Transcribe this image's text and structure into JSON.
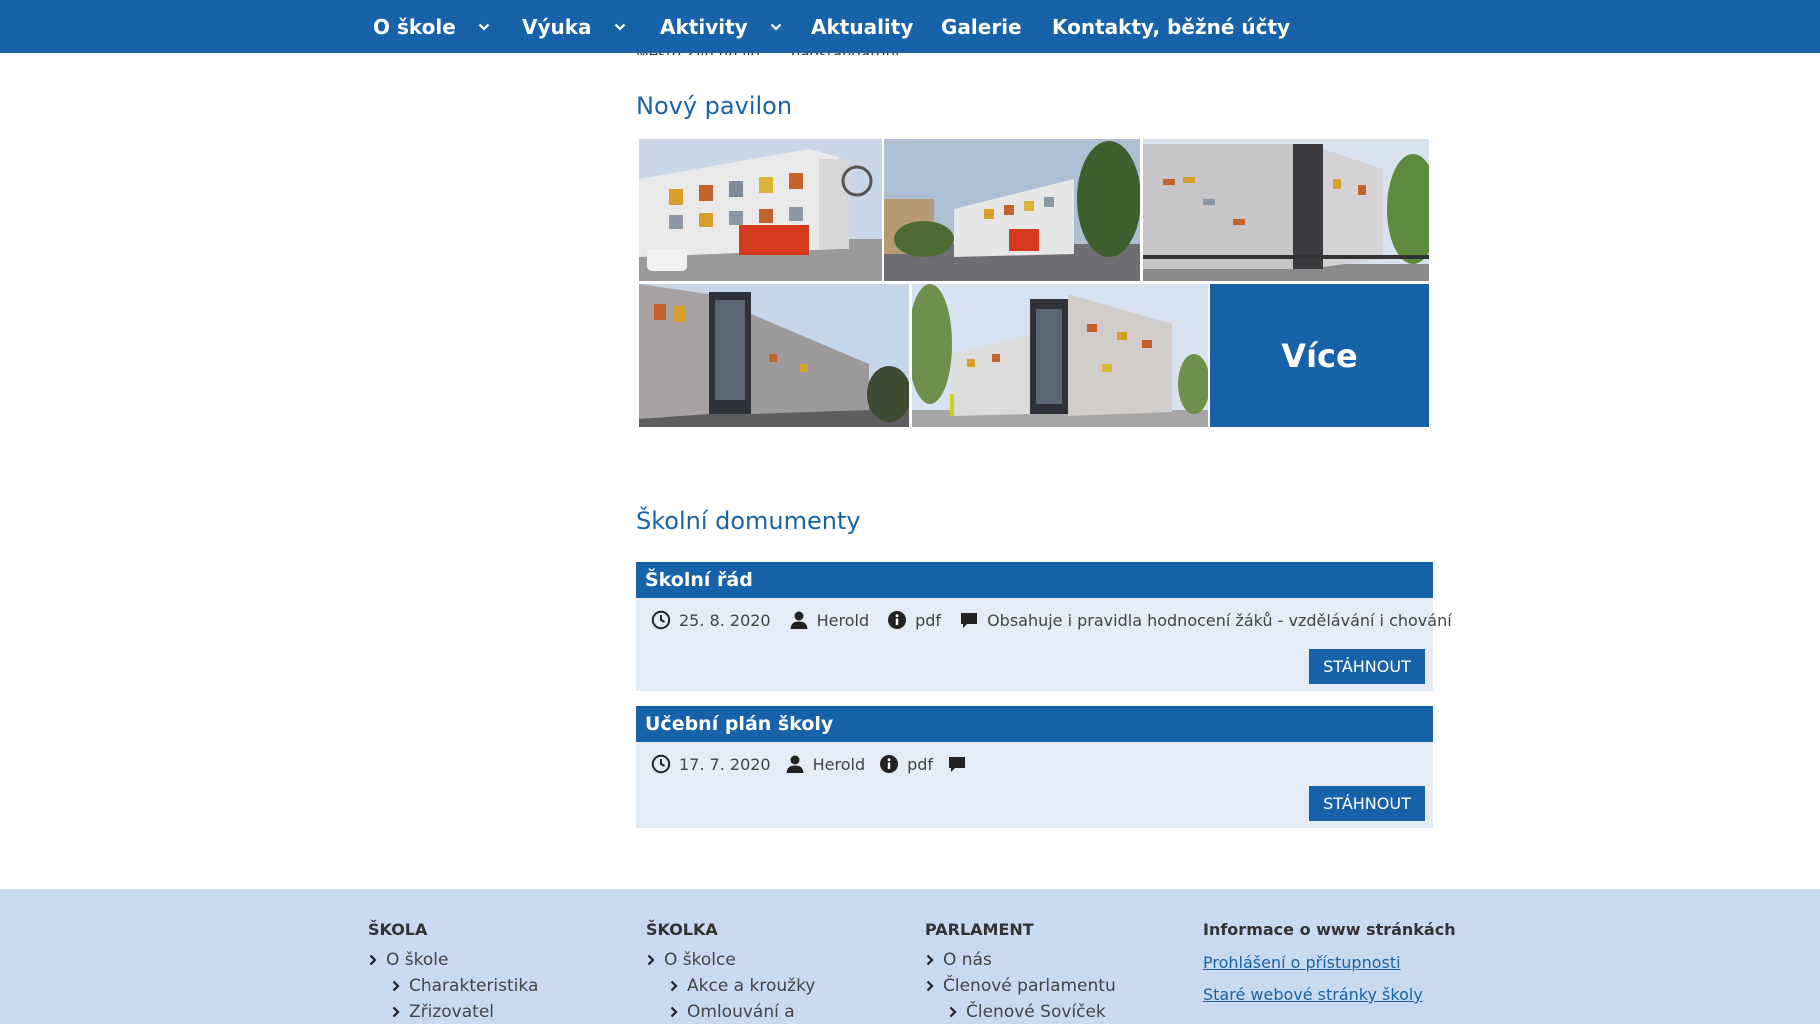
{
  "nav": {
    "items": [
      {
        "label": "O škole",
        "has_dropdown": true
      },
      {
        "label": "Výuka",
        "has_dropdown": true
      },
      {
        "label": "Aktivity",
        "has_dropdown": true
      },
      {
        "label": "Aktuality",
        "has_dropdown": false
      },
      {
        "label": "Galerie",
        "has_dropdown": false
      },
      {
        "label": "Kontakty, běžné účty",
        "has_dropdown": false
      }
    ]
  },
  "clipped_text": "Město Zlín určilo ... „nadstandardní“",
  "gallery": {
    "title": "Nový pavilon",
    "more_label": "Více"
  },
  "documents": {
    "title": "Školní domumenty",
    "items": [
      {
        "title": "Školní řád",
        "date": "25. 8. 2020",
        "author": "Herold",
        "type": "pdf",
        "note": "Obsahuje i pravidla hodnocení žáků - vzdělávání i chování",
        "button": "STÁHNOUT"
      },
      {
        "title": "Učební plán školy",
        "date": "17. 7. 2020",
        "author": "Herold",
        "type": "pdf",
        "note": "",
        "button": "STÁHNOUT"
      }
    ]
  },
  "footer": {
    "skola": {
      "title": "ŠKOLA",
      "items": [
        "O škole",
        "Charakteristika",
        "Zřizovatel"
      ]
    },
    "skolka": {
      "title": "ŠKOLKA",
      "items": [
        "O školce",
        "Akce a kroužky",
        "Omlouvání a"
      ]
    },
    "parlament": {
      "title": "PARLAMENT",
      "items": [
        "O nás",
        "Členové parlamentu",
        "Členové Sovíček"
      ]
    },
    "info": {
      "title": "Informace o www stránkách",
      "links": [
        "Prohlášení o přístupnosti",
        "Staré webové stránky školy"
      ]
    }
  },
  "colors": {
    "brand": "#1762a8",
    "panel": "#e4ecf7",
    "footer": "#c9daf0",
    "heading": "#1a64a6"
  }
}
